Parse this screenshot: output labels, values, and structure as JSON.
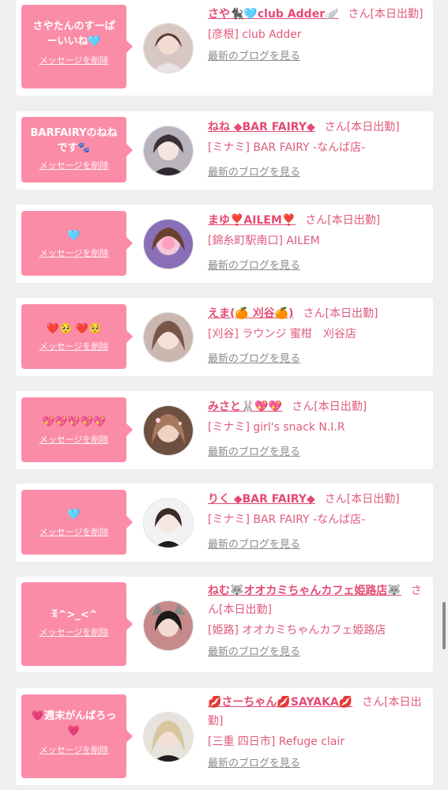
{
  "delete_label": "メッセージを削除",
  "blog_label": "最新のブログを見る",
  "cards": [
    {
      "bubble_lines": [
        "さやたんのすーぱ",
        "ーいいね🩵"
      ],
      "name": "さや🐈‍⬛🩵club Adder🪽",
      "san": "さん[本日出勤]",
      "shop": "[彦根] club Adder",
      "avatar_icon": "avatar-photo"
    },
    {
      "bubble_lines": [
        "BARFAIRYのねね",
        "です🐾"
      ],
      "name": "ねね ◆BAR FAIRY◆",
      "san": "さん[本日出勤]",
      "shop": "[ミナミ] BAR FAIRY -なんば店-",
      "avatar_icon": "avatar-photo"
    },
    {
      "bubble_lines": [
        "🩵"
      ],
      "name": "まゆ❣️AILEM❣️",
      "san": "さん[本日出勤]",
      "shop": "[錦糸町駅南口] AILEM",
      "avatar_icon": "avatar-photo"
    },
    {
      "bubble_lines": [
        "❤️🥺 ❤️🥺"
      ],
      "name": "えま(🍊 刈谷🍊)",
      "san": "さん[本日出勤]",
      "shop": "[刈谷] ラウンジ 蜜柑　刈谷店",
      "avatar_icon": "avatar-photo"
    },
    {
      "bubble_lines": [
        "💖💖💖💖💖"
      ],
      "name": "みさと🐰💖💖",
      "san": "さん[本日出勤]",
      "shop": "[ミナミ] girl's snack N.I.R",
      "avatar_icon": "avatar-photo"
    },
    {
      "bubble_lines": [
        "🩵"
      ],
      "name": "りく ◆BAR FAIRY◆",
      "san": "さん[本日出勤]",
      "shop": "[ミナミ] BAR FAIRY -なんば店-",
      "avatar_icon": "avatar-photo"
    },
    {
      "bubble_lines": [
        "ꉂ^>_<^"
      ],
      "name": "ねむ🐺オオカミちゃんカフェ姫路店🐺",
      "san": "さん[本日出勤]",
      "shop": "[姫路] オオカミちゃんカフェ姫路店",
      "avatar_icon": "avatar-photo"
    },
    {
      "bubble_lines": [
        "💗週末がんばろっ",
        "💗"
      ],
      "name": "💋さーちゃん💋SAYAKA💋",
      "san": "さん[本日出勤]",
      "shop": "[三重 四日市] Refuge clair",
      "avatar_icon": "avatar-photo"
    }
  ],
  "colors": {
    "bubble": "#fb8ca8",
    "name": "#e54a73",
    "text": "#e05a7c",
    "link": "#8a8a8a",
    "bg": "#efefef"
  }
}
